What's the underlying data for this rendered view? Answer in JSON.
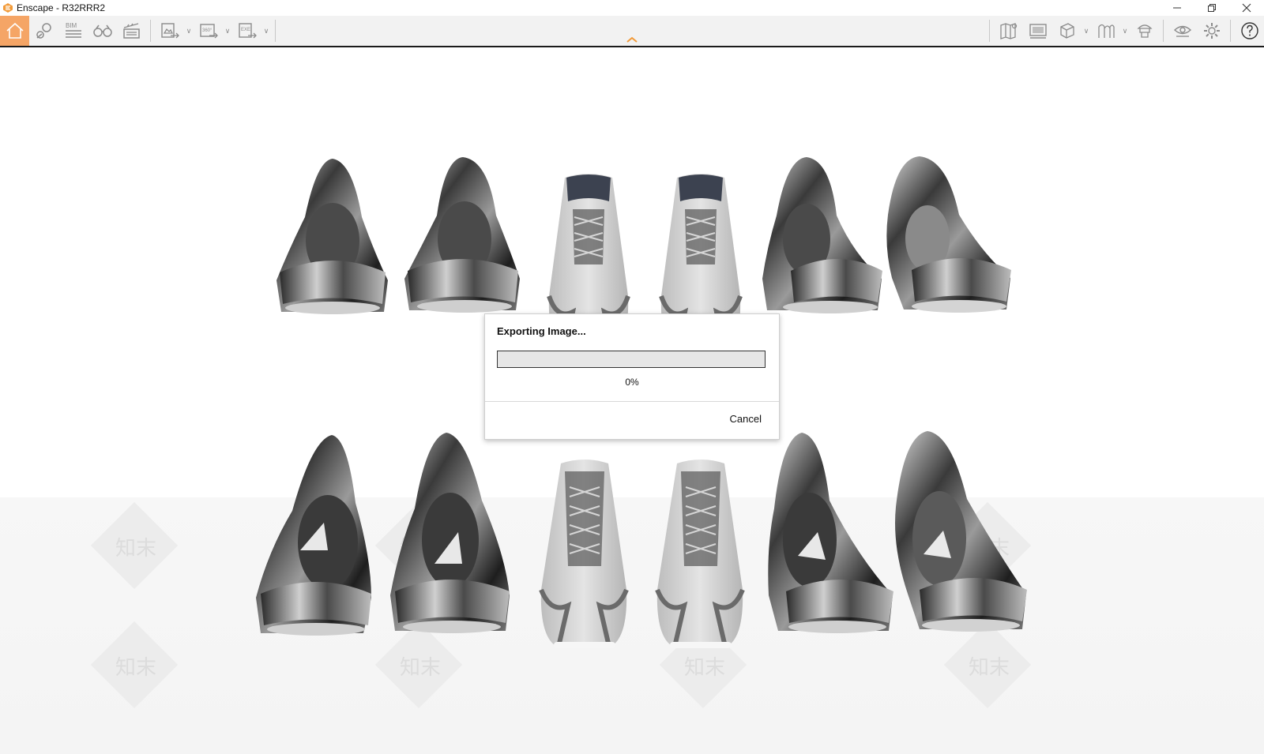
{
  "window": {
    "title": "Enscape - R32RRR2",
    "controls": [
      "minimize",
      "restore",
      "close"
    ]
  },
  "toolbar": {
    "left_buttons": [
      {
        "name": "home-icon",
        "active": true
      },
      {
        "name": "location-pin-icon"
      },
      {
        "name": "bim-icon",
        "label": "BIM"
      },
      {
        "name": "binoculars-icon"
      },
      {
        "name": "clapperboard-icon"
      },
      {
        "name": "export-image-icon",
        "dropdown": true
      },
      {
        "name": "export-panorama-icon",
        "label": "360°",
        "dropdown": true
      },
      {
        "name": "export-exe-icon",
        "label": "EXE",
        "dropdown": true
      }
    ],
    "right_buttons": [
      {
        "name": "map-icon"
      },
      {
        "name": "billboard-icon"
      },
      {
        "name": "cube-icon",
        "dropdown": true
      },
      {
        "name": "silhouette-icon",
        "dropdown": true
      },
      {
        "name": "asset-library-icon"
      },
      {
        "name": "eye-icon"
      },
      {
        "name": "gear-icon"
      },
      {
        "name": "help-icon"
      }
    ],
    "accent_color": "#f5a566"
  },
  "watermark_text": "知末",
  "dialog": {
    "title": "Exporting Image...",
    "progress_percent": 0,
    "progress_text": "0%",
    "cancel_label": "Cancel"
  }
}
